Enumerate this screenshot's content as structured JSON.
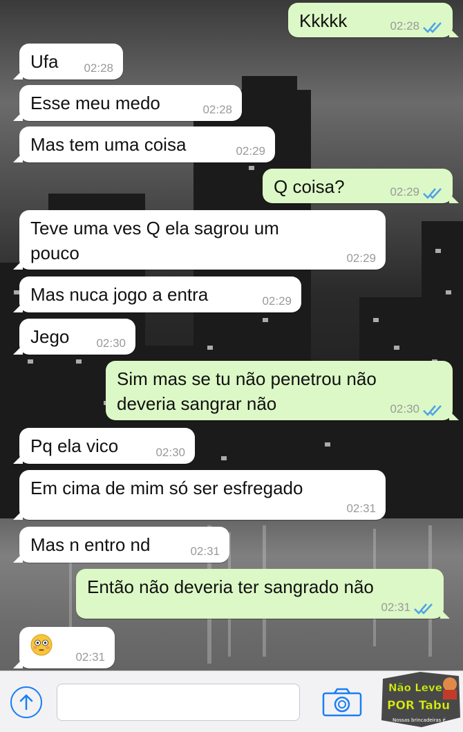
{
  "messages": [
    {
      "dir": "out",
      "text": "Kkkkk",
      "time": "02:28",
      "read": true
    },
    {
      "dir": "in",
      "text": "Ufa",
      "time": "02:28"
    },
    {
      "dir": "in",
      "text": "Esse meu medo",
      "time": "02:28"
    },
    {
      "dir": "in",
      "text": "Mas tem uma coisa",
      "time": "02:29"
    },
    {
      "dir": "out",
      "text": "Q coisa?",
      "time": "02:29",
      "read": true
    },
    {
      "dir": "in",
      "text": "Teve uma ves Q ela sagrou um",
      "text2": "pouco",
      "time": "02:29"
    },
    {
      "dir": "in",
      "text": "Mas nuca jogo a entra",
      "time": "02:29"
    },
    {
      "dir": "in",
      "text": "Jego",
      "time": "02:30"
    },
    {
      "dir": "out",
      "text": "Sim mas se tu não penetrou não",
      "text2": "deveria sangrar não",
      "time": "02:30",
      "read": true
    },
    {
      "dir": "in",
      "text": "Pq ela vico",
      "time": "02:30"
    },
    {
      "dir": "in",
      "text": "Em cima de mim só ser esfregado",
      "time": "02:31"
    },
    {
      "dir": "in",
      "text": "Mas n entro nd",
      "time": "02:31"
    },
    {
      "dir": "out",
      "text": "Então não deveria ter sangrado não",
      "time": "02:31",
      "read": true
    },
    {
      "dir": "in",
      "emoji": "flushed-face-emoji",
      "time": "02:31"
    }
  ],
  "toolbar": {
    "upload_icon": "upload-arrow-icon",
    "camera_icon": "camera-icon",
    "input_value": ""
  },
  "watermark": {
    "line1": "Não Leve",
    "line2": "POR Tabu",
    "line3": "Nossas brincadeiras é..."
  },
  "colors": {
    "incoming_bubble": "#ffffff",
    "outgoing_bubble": "#dcf8c6",
    "read_ticks": "#4fa3e6",
    "ios_blue": "#1a7ef5"
  }
}
